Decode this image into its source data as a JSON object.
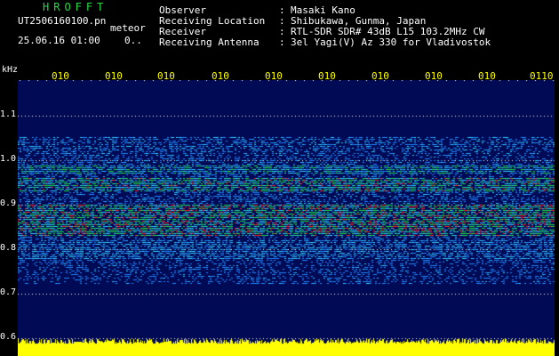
{
  "header": {
    "app_title": "HROFFT",
    "filename": "UT2506160100.pn",
    "mode": "meteor",
    "datetime": "25.06.16 01:00",
    "stat": "0.."
  },
  "station": [
    {
      "label": "Observer",
      "sep": ":",
      "value": "Masaki Kano"
    },
    {
      "label": "Receiving Location",
      "sep": ":",
      "value": "Shibukawa, Gunma, Japan"
    },
    {
      "label": "Receiver",
      "sep": ":",
      "value": "RTL-SDR SDR# 43dB L15 103.2MHz CW"
    },
    {
      "label": "Receiving Antenna",
      "sep": ":",
      "value": "3el Yagi(V) Az 330 for Vladivostok"
    }
  ],
  "axis": {
    "unit": "kHz",
    "y_labels": [
      "1.1",
      "1.0",
      "0.9",
      "0.8",
      "0.7",
      "0.6"
    ],
    "x_labels": [
      "010",
      "010",
      "010",
      "010",
      "010",
      "010",
      "010",
      "010",
      "010",
      "0110"
    ]
  },
  "colors": {
    "background": "#000a55",
    "signal_strong": "#ff2222",
    "signal_mid": "#22dd44",
    "signal_low": "#2288ff",
    "amplitude": "#ffff00"
  }
}
